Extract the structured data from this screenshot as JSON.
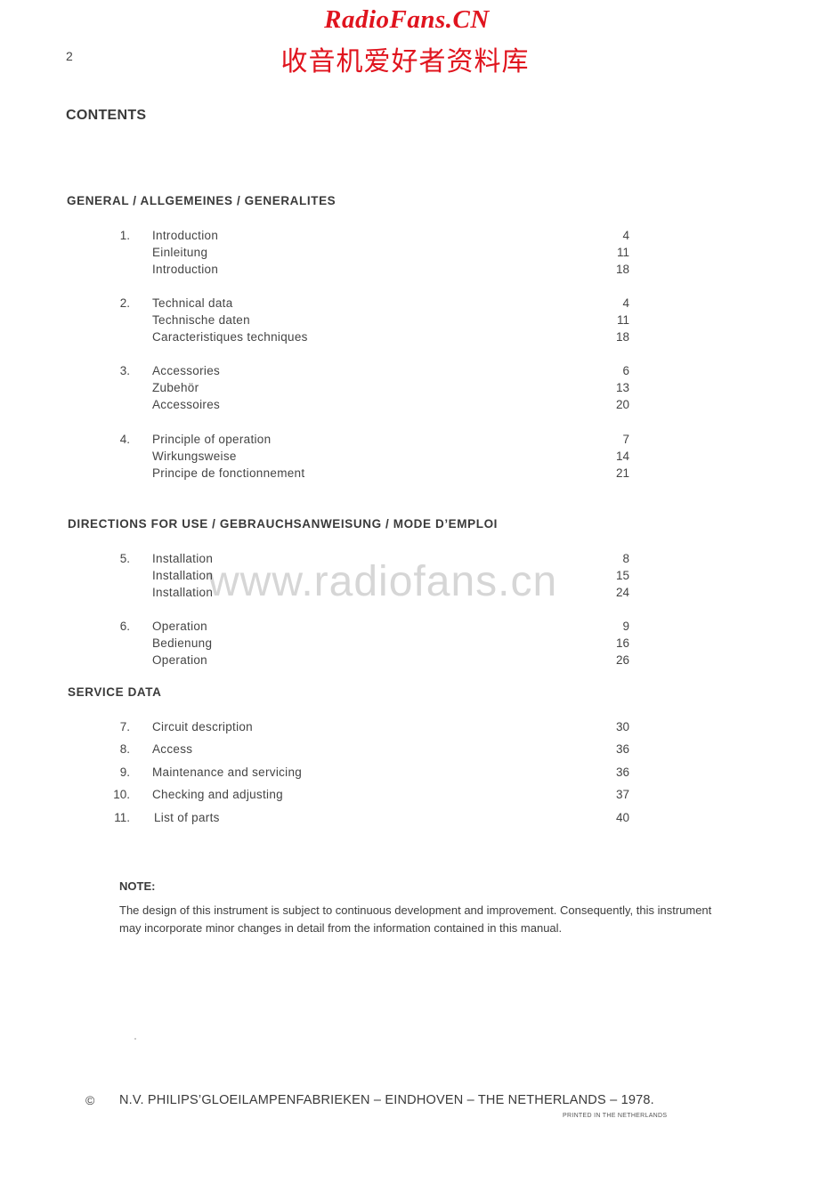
{
  "watermark": {
    "title": "RadioFans.CN",
    "subtitle": "收音机爱好者资料库",
    "web": "www.radiofans.cn",
    "color": "#e0141e"
  },
  "page": {
    "number": "2",
    "title": "CONTENTS"
  },
  "sections": [
    {
      "heading": "GENERAL /  ALLGEMEINES  /  GENERALITES",
      "entries": [
        {
          "num": "1.",
          "lines": [
            {
              "label": "Introduction",
              "page": "4"
            },
            {
              "label": "Einleitung",
              "page": "11"
            },
            {
              "label": "Introduction",
              "page": "18"
            }
          ]
        },
        {
          "num": "2.",
          "lines": [
            {
              "label": "Technical data",
              "page": "4"
            },
            {
              "label": "Technische daten",
              "page": "11"
            },
            {
              "label": "Caracteristiques techniques",
              "page": "18"
            }
          ]
        },
        {
          "num": "3.",
          "lines": [
            {
              "label": "Accessories",
              "page": "6"
            },
            {
              "label": "Zubehör",
              "page": "13"
            },
            {
              "label": "Accessoires",
              "page": "20"
            }
          ]
        },
        {
          "num": "4.",
          "lines": [
            {
              "label": "Principle of operation",
              "page": "7"
            },
            {
              "label": "Wirkungsweise",
              "page": "14"
            },
            {
              "label": "Principe de fonctionnement",
              "page": "21"
            }
          ]
        }
      ]
    },
    {
      "heading": "DIRECTIONS FOR USE  /  GEBRAUCHSANWEISUNG  /  MODE D’EMPLOI",
      "entries": [
        {
          "num": "5.",
          "lines": [
            {
              "label": "Installation",
              "page": "8"
            },
            {
              "label": "Installation",
              "page": "15"
            },
            {
              "label": "Installation",
              "page": "24"
            }
          ]
        },
        {
          "num": "6.",
          "lines": [
            {
              "label": "Operation",
              "page": "9"
            },
            {
              "label": "Bedienung",
              "page": "16"
            },
            {
              "label": "Operation",
              "page": "26"
            }
          ]
        }
      ]
    },
    {
      "heading": "SERVICE DATA",
      "entries": [
        {
          "num": "7.",
          "lines": [
            {
              "label": "Circuit description",
              "page": "30"
            }
          ]
        },
        {
          "num": "8.",
          "lines": [
            {
              "label": "Access",
              "page": "36"
            }
          ]
        },
        {
          "num": "9.",
          "lines": [
            {
              "label": "Maintenance and servicing",
              "page": "36"
            }
          ]
        },
        {
          "num": "10.",
          "lines": [
            {
              "label": "Checking and adjusting",
              "page": "37"
            }
          ]
        },
        {
          "num": "11.",
          "lines": [
            {
              "label": "List of parts",
              "page": "40"
            }
          ]
        }
      ]
    }
  ],
  "note": {
    "label": "NOTE:",
    "text": "The design of this instrument is subject to continuous development and improvement. Consequently, this instrument may incorporate minor changes in detail from the information contained in this manual."
  },
  "footer": {
    "copyright_symbol": "©",
    "text": "N.V. PHILIPS’GLOEILAMPENFABRIEKEN – EINDHOVEN – THE NETHERLANDS – 1978.",
    "printed": "PRINTED IN THE NETHERLANDS"
  }
}
